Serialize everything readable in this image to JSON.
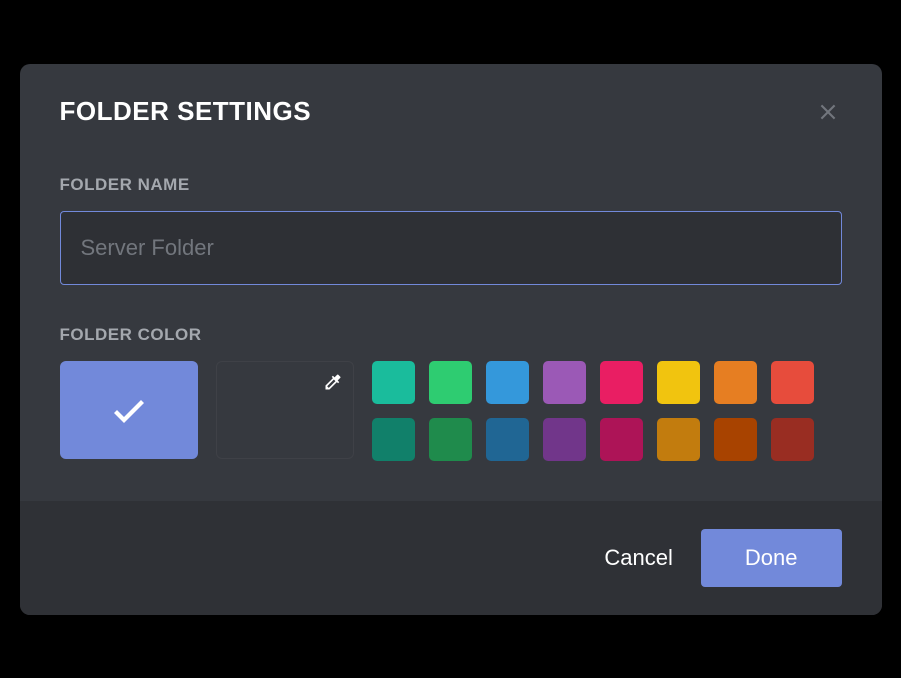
{
  "modal": {
    "title": "FOLDER SETTINGS",
    "name_section_label": "FOLDER NAME",
    "name_placeholder": "Server Folder",
    "name_value": "",
    "color_section_label": "FOLDER COLOR",
    "default_color": "#7289da",
    "swatches_row1": [
      "#1abc9c",
      "#2ecc71",
      "#3498db",
      "#9b59b6",
      "#e91e63",
      "#f1c40f",
      "#e67e22",
      "#e74c3c"
    ],
    "swatches_row2": [
      "#11806a",
      "#1f8b4c",
      "#206694",
      "#71368a",
      "#ad1457",
      "#c27c0e",
      "#a84300",
      "#992d22"
    ]
  },
  "footer": {
    "cancel_label": "Cancel",
    "done_label": "Done"
  }
}
